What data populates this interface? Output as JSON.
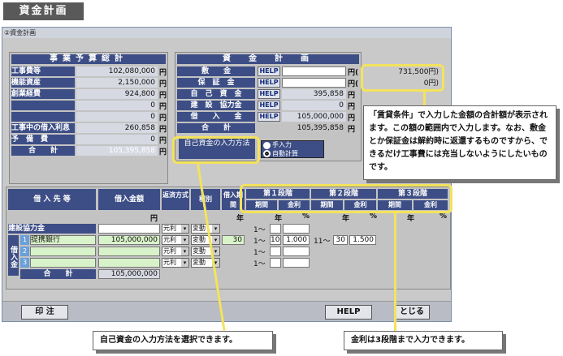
{
  "tag": "資金計画",
  "window_title": "②資金計画",
  "budget": {
    "header": "事業予算総計",
    "rows": [
      {
        "label": "工事費等",
        "value": "102,080,000",
        "unit": "円"
      },
      {
        "label": "機能資産",
        "value": "2,150,000",
        "unit": "円"
      },
      {
        "label": "創業経費",
        "value": "924,800",
        "unit": "円"
      },
      {
        "label": "",
        "value": "0",
        "unit": "円"
      },
      {
        "label": "",
        "value": "0",
        "unit": "円"
      },
      {
        "label": "工事中の借入利息",
        "value": "260,858",
        "unit": "円"
      },
      {
        "label": "予　備　費",
        "value": "0",
        "unit": "円"
      }
    ],
    "total_label": "合　　計",
    "total_value": "105,395,858",
    "total_unit": "円"
  },
  "funds": {
    "header": "資　金　計　画",
    "help": "HELP",
    "rows": [
      {
        "label": "敷　　金",
        "value": "",
        "unit": "円(",
        "right": "731,500円)"
      },
      {
        "label": "保　証　金",
        "value": "",
        "unit": "円(",
        "right": "0円)"
      },
      {
        "label": "自　己　資　金",
        "value": "395,858",
        "unit": "円"
      },
      {
        "label": "建　設　協力金",
        "value": "0",
        "unit": "円"
      },
      {
        "label": "借　　入　　金",
        "value": "105,000,000",
        "unit": "円"
      }
    ],
    "total_label": "合　　計",
    "total_value": "105,395,858",
    "total_unit": "円",
    "self_method_label": "自己資金の入力方法",
    "opt_manual": "手入力",
    "opt_auto": "自動計算"
  },
  "callout_top": "「賃貸条件」で入力した金額の合計額が表示されます。この額の範囲内で入力します。なお、敷金とか保証金は解約時に返還するものですから、できるだけ工事費には充当しないようにしたいものです。",
  "callout_bl": "自己資金の入力方法を選択できます。",
  "callout_br": "金利は3段階まで入力できます。",
  "loans": {
    "headers": {
      "lender": "借 入 先 等",
      "amount": "借入金額",
      "method": "返済方式",
      "type": "種別",
      "period": "借入期間",
      "s1": "第１段階",
      "s2": "第２段階",
      "s3": "第３段階",
      "kikan": "期間",
      "kinri": "金利"
    },
    "unit_en": "円",
    "unit_nen": "年",
    "unit_pct": "%",
    "kyoryoku_label": "建設協力金",
    "side_label": "借入金",
    "rows": [
      {
        "num": "1",
        "name": "提携銀行",
        "amount": "105,000,000",
        "method": "元利",
        "type": "変動",
        "period": "30",
        "p1from": "1〜",
        "p1to": "10",
        "r1": "1.000",
        "p2from": "11〜",
        "p2to": "30",
        "r2": "1.500"
      },
      {
        "num": "2",
        "name": "",
        "amount": "",
        "method": "元利",
        "type": "変動",
        "period": "",
        "p1from": "1〜",
        "p1to": "",
        "r1": "",
        "p2from": "",
        "p2to": "",
        "r2": ""
      },
      {
        "num": "3",
        "name": "",
        "amount": "",
        "method": "元利",
        "type": "変動",
        "period": "",
        "p1from": "1〜",
        "p1to": "",
        "r1": "",
        "p2from": "",
        "p2to": "",
        "r2": ""
      }
    ],
    "kyoryoku_row": {
      "method": "元利",
      "type": "変動",
      "p1from": "1〜"
    },
    "total_label": "合　　計",
    "total_value": "105,000,000"
  },
  "buttons": {
    "print": "印 注",
    "help": "HELP",
    "close": "とじる"
  },
  "colors": {
    "label_bg": "#3d4e86",
    "highlight": "#f3e35c",
    "window_bg": "#c9c9c9"
  }
}
